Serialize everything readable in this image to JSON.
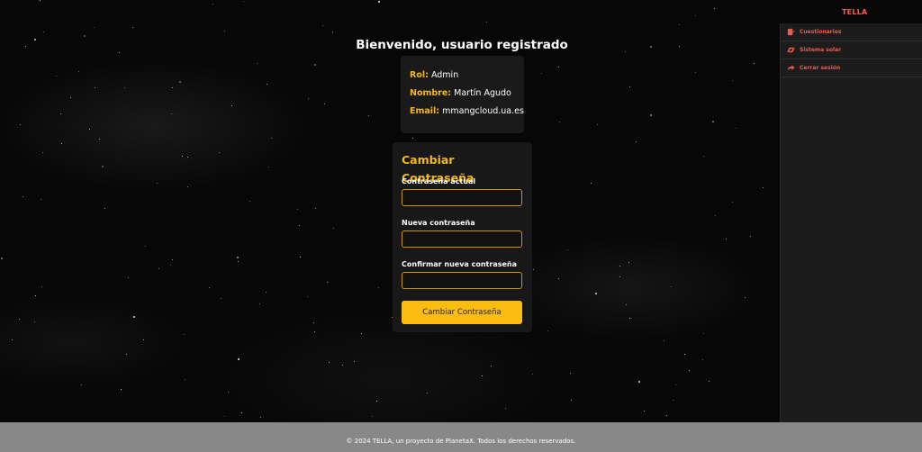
{
  "brand": {
    "name": "TELLA"
  },
  "side_menu": {
    "items": [
      {
        "label": "Cuestionarios",
        "icon": "quiz-icon"
      },
      {
        "label": "Sistema solar",
        "icon": "planet-icon"
      },
      {
        "label": "Cerrar sesión",
        "icon": "logout-arrow-icon"
      }
    ]
  },
  "welcome": {
    "title": "Bienvenido, usuario registrado"
  },
  "profile": {
    "role_label": "Rol:",
    "role_value": "Admin",
    "name_label": "Nombre:",
    "name_value": "Martín Agudo",
    "email_label": "Email:",
    "email_value": "mmangcloud.ua.es"
  },
  "change_password": {
    "title": "Cambiar Contraseña",
    "current_label": "Contraseña actual",
    "current_value": "",
    "new_label": "Nueva contraseña",
    "new_value": "",
    "confirm_label": "Confirmar nueva contraseña",
    "confirm_value": "",
    "submit_label": "Cambiar Contraseña"
  },
  "footer": {
    "text": "© 2024 TELLA, un proyecto de PlanetaX. Todos los derechos reservados."
  },
  "colors": {
    "accent": "#f5b716",
    "menu_text": "#f05a4c",
    "card_bg": "#1a1a1a",
    "footer_bg": "#888888"
  }
}
